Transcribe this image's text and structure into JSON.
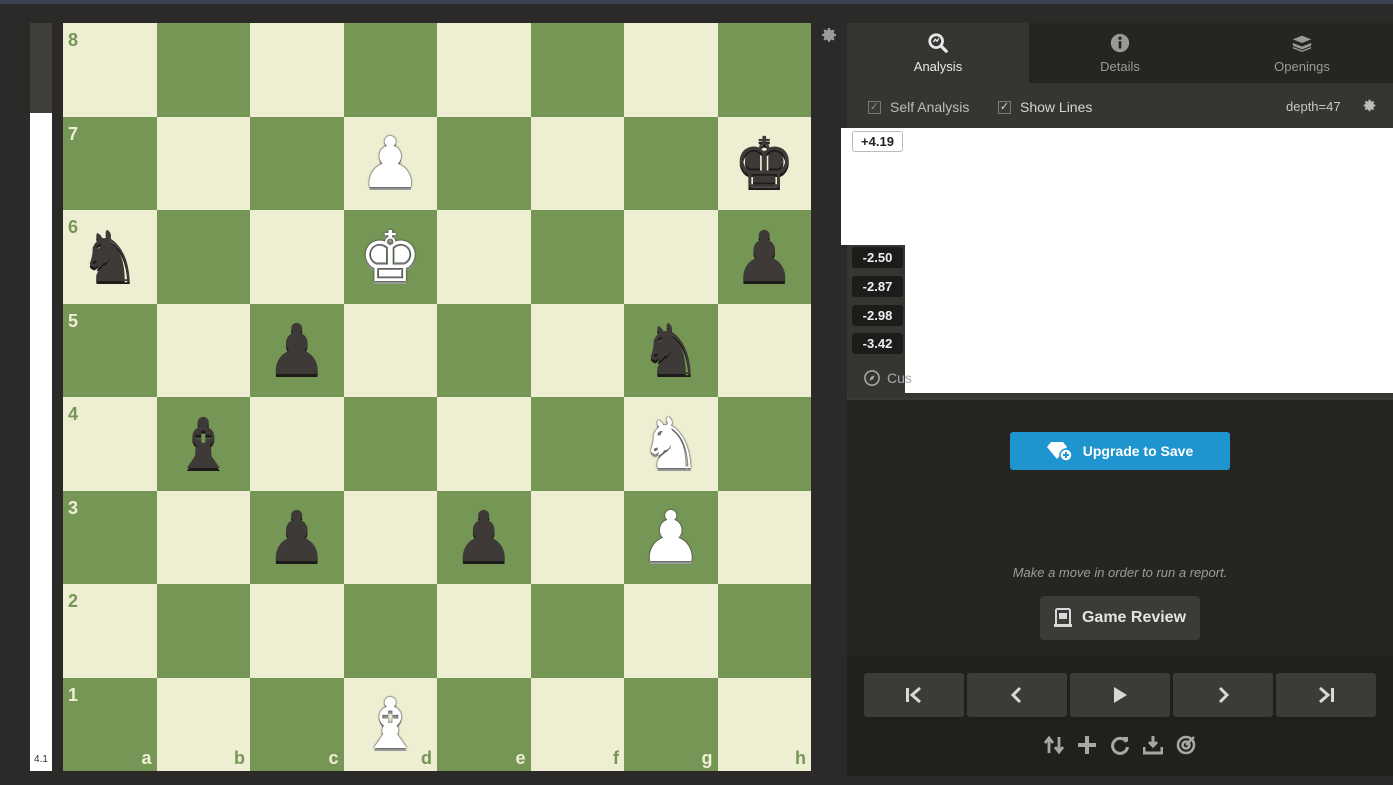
{
  "eval_bar": {
    "label": "4.1",
    "white_fraction": 0.88
  },
  "board": {
    "ranks": [
      "8",
      "7",
      "6",
      "5",
      "4",
      "3",
      "2",
      "1"
    ],
    "files": [
      "a",
      "b",
      "c",
      "d",
      "e",
      "f",
      "g",
      "h"
    ],
    "pieces": [
      {
        "square": "d7",
        "color": "w",
        "type": "pawn",
        "glyph": "♟"
      },
      {
        "square": "h7",
        "color": "b",
        "type": "king",
        "glyph": "♚"
      },
      {
        "square": "a6",
        "color": "b",
        "type": "knight",
        "glyph": "♞"
      },
      {
        "square": "d6",
        "color": "w",
        "type": "king",
        "glyph": "♚"
      },
      {
        "square": "h6",
        "color": "b",
        "type": "pawn",
        "glyph": "♟"
      },
      {
        "square": "c5",
        "color": "b",
        "type": "pawn",
        "glyph": "♟"
      },
      {
        "square": "g5",
        "color": "b",
        "type": "knight",
        "glyph": "♞"
      },
      {
        "square": "b4",
        "color": "b",
        "type": "bishop",
        "glyph": "♝"
      },
      {
        "square": "g4",
        "color": "w",
        "type": "knight",
        "glyph": "♞"
      },
      {
        "square": "c3",
        "color": "b",
        "type": "pawn",
        "glyph": "♟"
      },
      {
        "square": "e3",
        "color": "b",
        "type": "pawn",
        "glyph": "♟"
      },
      {
        "square": "g3",
        "color": "w",
        "type": "pawn",
        "glyph": "♟"
      },
      {
        "square": "d1",
        "color": "w",
        "type": "bishop",
        "glyph": "♝"
      }
    ],
    "settings_icon": "gear-icon"
  },
  "tabs": [
    {
      "label": "Analysis",
      "icon": "magnifier-icon",
      "active": true
    },
    {
      "label": "Details",
      "icon": "info-icon",
      "active": false
    },
    {
      "label": "Openings",
      "icon": "book-stack-icon",
      "active": false
    }
  ],
  "options": {
    "self_analysis": {
      "label": "Self Analysis",
      "checked": true
    },
    "show_lines": {
      "label": "Show Lines",
      "checked": true
    },
    "depth": "depth=47"
  },
  "lines": {
    "scores": [
      "+4.19",
      "-2.50",
      "-2.87",
      "-2.98",
      "-3.42"
    ],
    "custom_label": "Cus"
  },
  "upgrade": {
    "label": "Upgrade to Save"
  },
  "review": {
    "hint": "Make a move in order to run a report.",
    "label": "Game Review"
  },
  "nav": {
    "buttons": [
      "first-move-icon",
      "previous-move-icon",
      "play-icon",
      "next-move-icon",
      "last-move-icon"
    ],
    "tools": [
      "flip-board-icon",
      "add-icon",
      "reset-icon",
      "download-icon",
      "target-icon"
    ]
  },
  "colors": {
    "light_square": "#eeeed2",
    "dark_square": "#769656",
    "accent": "#1f95cf"
  }
}
